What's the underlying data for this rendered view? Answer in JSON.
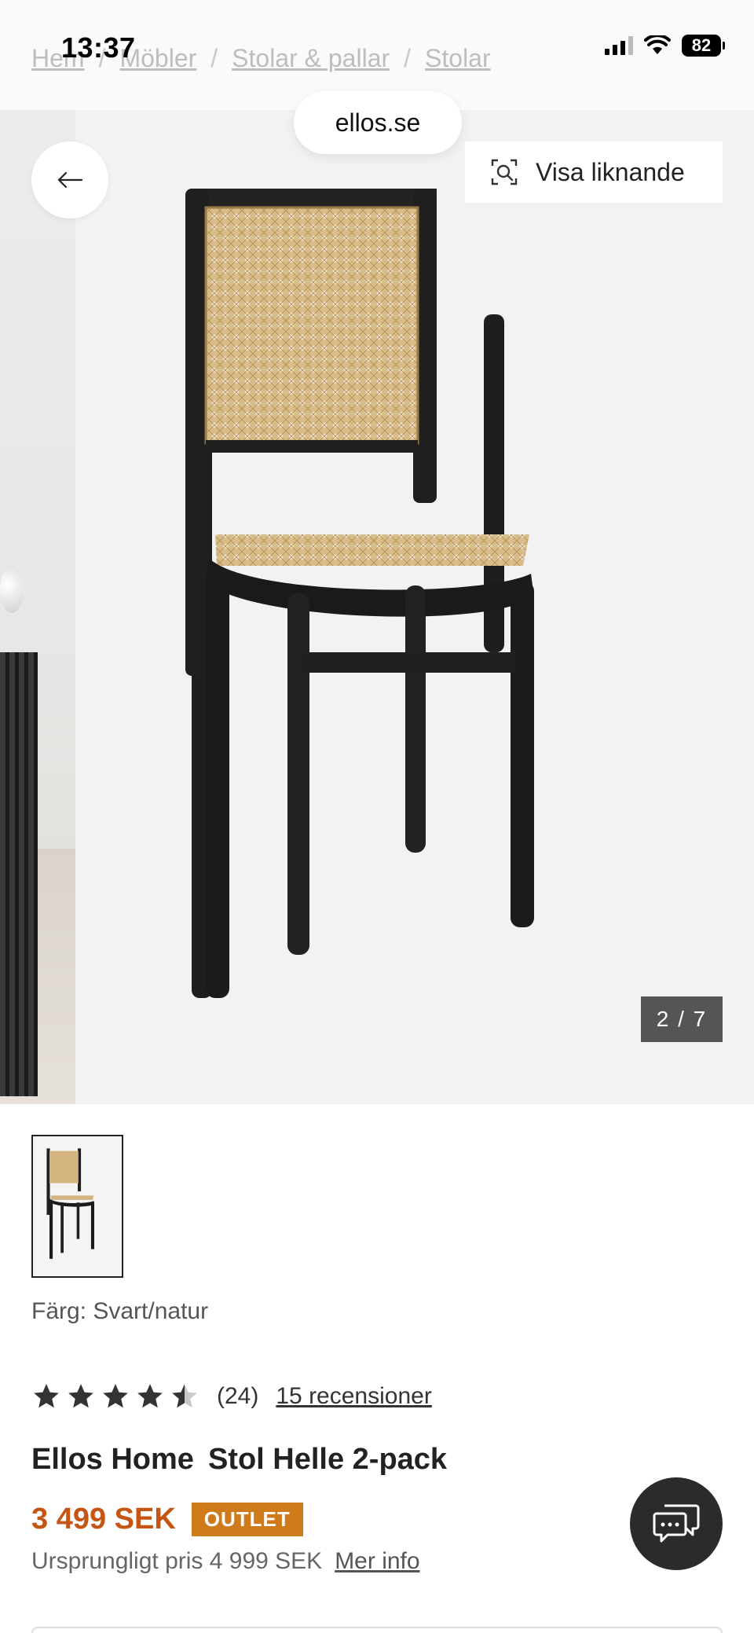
{
  "status_bar": {
    "time": "13:37",
    "battery": "82"
  },
  "breadcrumb": [
    "Hem",
    "Möbler",
    "Stolar & pallar",
    "Stolar"
  ],
  "browser": {
    "url": "ellos.se"
  },
  "gallery": {
    "similar_label": "Visa liknande",
    "counter": "2 / 7"
  },
  "product": {
    "color_label": "Färg: Svart/natur",
    "rating": 4.5,
    "rating_count": "(24)",
    "reviews_link": "15 recensioner",
    "brand": "Ellos Home",
    "name": "Stol Helle 2-pack",
    "price": "3 499 SEK",
    "badge": "OUTLET",
    "original_price": "Ursprungligt pris 4 999 SEK",
    "more_info": "Mer info"
  },
  "colors": {
    "price": "#c45513",
    "badge": "#cf7b1c",
    "chat_button": "#2b2b2b"
  },
  "icons": [
    "back-arrow-icon",
    "visual-search-icon",
    "star-icon",
    "chat-icon",
    "signal-icon",
    "wifi-icon",
    "battery-icon"
  ]
}
